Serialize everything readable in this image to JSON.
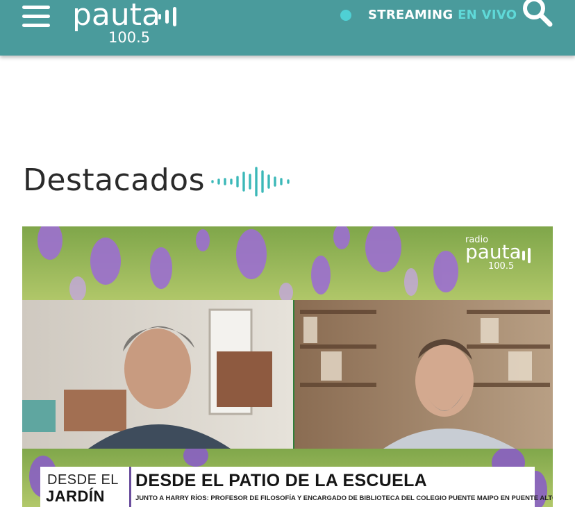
{
  "header": {
    "logo": {
      "word": "pauta",
      "frequency": "100.5"
    },
    "streaming": {
      "label": "STREAMING",
      "live": "EN VIVO",
      "dot_color": "#4fd0d4"
    },
    "background_color": "#4a9b9c",
    "icons": {
      "menu": "hamburger-menu-icon",
      "search": "search-icon"
    }
  },
  "section": {
    "title": "Destacados",
    "wave_icon": "sound-wave-icon",
    "accent_color": "#3cb8b8"
  },
  "featured": {
    "logo": {
      "top": "radio",
      "word": "pauta",
      "frequency": "100.5"
    },
    "lower_third": {
      "left_line1": "DESDE EL",
      "left_line2": "JARDÍN",
      "title": "DESDE EL PATIO DE LA ESCUELA",
      "subtitle": "JUNTO A HARRY RÍOS: PROFESOR DE FILOSOFÍA Y ENCARGADO DE BIBLIOTECA  DEL COLEGIO PUENTE MAIPO EN PUENTE ALTO"
    }
  }
}
